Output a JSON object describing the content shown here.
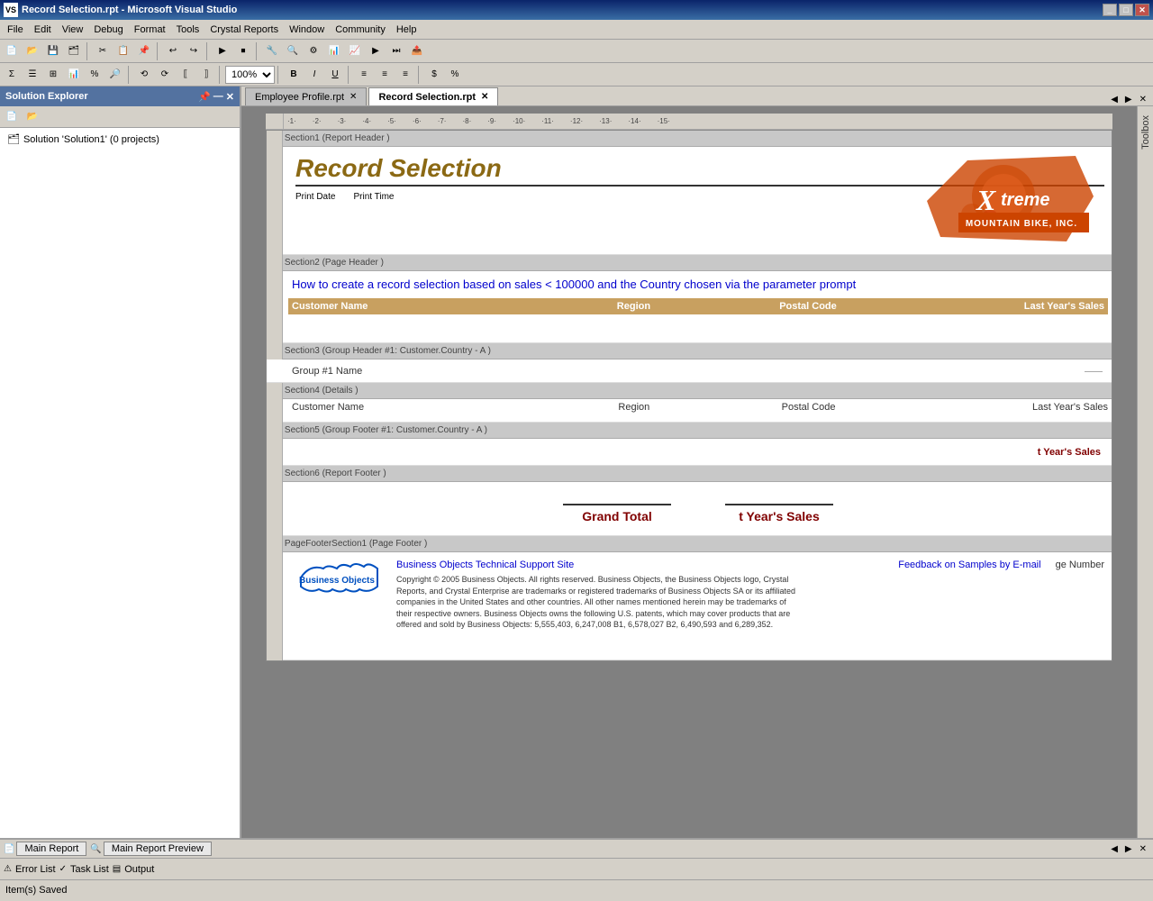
{
  "window": {
    "title": "Record Selection.rpt - Microsoft Visual Studio",
    "app_icon": "VS"
  },
  "menu": {
    "items": [
      "File",
      "Edit",
      "View",
      "Debug",
      "Format",
      "Tools",
      "Crystal Reports",
      "Window",
      "Community",
      "Help"
    ]
  },
  "toolbar": {
    "zoom": "100%"
  },
  "solution_explorer": {
    "title": "Solution Explorer",
    "solution_label": "Solution 'Solution1' (0 projects)"
  },
  "tabs": {
    "items": [
      {
        "label": "Employee Profile.rpt",
        "active": false
      },
      {
        "label": "Record Selection.rpt",
        "active": true
      }
    ]
  },
  "report": {
    "sections": {
      "section1": {
        "header": "Section1 (Report Header )",
        "title": "Record Selection",
        "print_date": "Print Date",
        "print_time": "Print Time"
      },
      "section2": {
        "header": "Section2 (Page Header )",
        "description": "How to create a record selection based on sales < 100000 and the Country chosen via the parameter prompt",
        "columns": {
          "customer_name": "Customer Name",
          "region": "Region",
          "postal_code": "Postal Code",
          "last_years_sales": "Last Year's Sales"
        }
      },
      "section3": {
        "header": "Section3 (Group Header #1: Customer.Country - A )",
        "group_name": "Group #1 Name"
      },
      "section4": {
        "header": "Section4 (Details )",
        "fields": {
          "customer_name": "Customer Name",
          "region": "Region",
          "postal_code": "Postal Code",
          "last_years_sales": "Last Year's Sales"
        }
      },
      "section5": {
        "header": "Section5 (Group Footer #1: Customer.Country - A )",
        "summary": "t Year's Sales"
      },
      "section6": {
        "header": "Section6 (Report Footer )",
        "grand_total_label": "Grand Total",
        "grand_total_value": "t Year's Sales"
      },
      "page_footer": {
        "header": "PageFooterSection1 (Page Footer )",
        "biz_objects": "Business Objects",
        "support_link": "Business Objects Technical Support Site",
        "feedback_link": "Feedback on Samples by E-mail",
        "copyright": "Copyright © 2005 Business Objects. All rights reserved. Business Objects, the Business Objects logo, Crystal Reports, and Crystal Enterprise are trademarks or registered trademarks of Business Objects SA or its affiliated companies in the United States and other countries. All other names mentioned herein may be trademarks of their respective owners. Business Objects owns the following U.S. patents, which may cover products that are offered and sold by Business Objects: 5,555,403, 6,247,008 B1, 6,578,027 B2, 6,490,593 and 6,289,352.",
        "page_number": "ge Number"
      }
    }
  },
  "bottom_tabs": {
    "items": [
      {
        "label": "Main Report",
        "icon": "doc"
      },
      {
        "label": "Main Report Preview",
        "icon": "preview"
      }
    ]
  },
  "status_bar": {
    "message": "Item(s) Saved"
  },
  "bottom_panels": {
    "error_list": "Error List",
    "task_list": "Task List",
    "output": "Output"
  },
  "xtreme_logo": {
    "text": "Xtreme",
    "subtitle": "MOUNTAIN BIKE, INC.",
    "accent_color": "#e06020"
  }
}
